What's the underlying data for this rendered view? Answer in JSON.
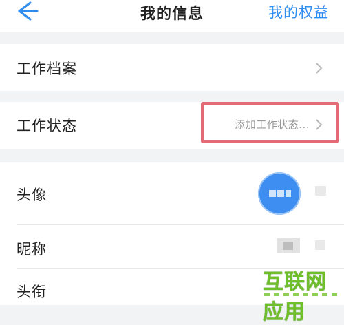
{
  "nav": {
    "title": "我的信息",
    "right_action": "我的权益"
  },
  "rows": {
    "archive": {
      "label": "工作档案"
    },
    "status": {
      "label": "工作状态",
      "hint": "添加工作状态..."
    }
  },
  "profile": {
    "avatar_label": "头像",
    "nickname_label": "昵称",
    "title_label": "头衔"
  },
  "watermark": {
    "text": "互联网应用"
  },
  "colors": {
    "accent": "#2f8df0",
    "highlight": "#e46b76",
    "watermark": "#6fbf2a"
  }
}
